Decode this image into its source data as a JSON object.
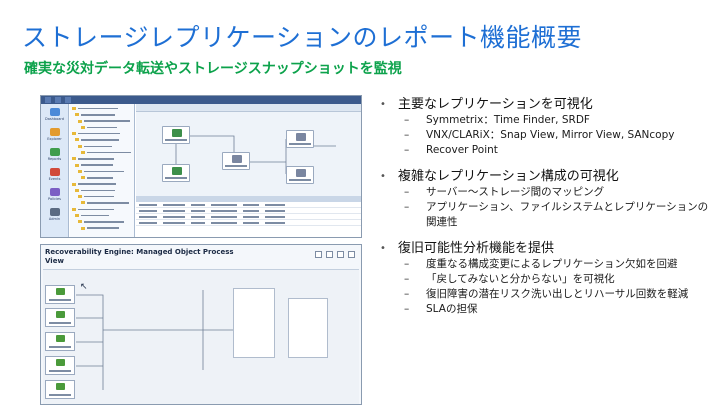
{
  "title": "ストレージレプリケーションのレポート機能概要",
  "subtitle": "確実な災対データ転送やストレージスナップショットを監視",
  "screenshot_top": {
    "nav_items": [
      "Dashboard",
      "Explorer",
      "Reports",
      "Events",
      "Policies",
      "Admin"
    ],
    "node_icons": [
      {
        "name": "app-node",
        "color": "#3d8f4a"
      },
      {
        "name": "host-node",
        "color": "#3d8f4a"
      },
      {
        "name": "storage-node",
        "color": "#7a86a0"
      },
      {
        "name": "array-node",
        "color": "#7a86a0"
      }
    ]
  },
  "screenshot_bottom": {
    "title_line1": "Recoverability Engine: Managed Object Process",
    "title_line2": "View"
  },
  "bullets": [
    {
      "label": "主要なレプリケーションを可視化",
      "subs": [
        [
          "Symmetrix：Time Finder, SRDF"
        ],
        [
          "VNX/CLARiX：Snap View, Mirror View, SANcopy"
        ],
        [
          "Recover Point"
        ]
      ]
    },
    {
      "label": "複雑なレプリケーション構成の可視化",
      "subs": [
        [
          "サーバー～ストレージ間のマッピング"
        ],
        [
          "アプリケーション、ファイルシステムとレプリケーションの",
          "関連性"
        ]
      ]
    },
    {
      "label": "復旧可能性分析機能を提供",
      "subs": [
        [
          "度重なる構成変更によるレプリケーション欠如を回避"
        ],
        [
          "「戻してみないと分からない」を可視化"
        ],
        [
          "復旧障害の潜在リスク洗い出しとリハーサル回数を軽減"
        ],
        [
          "SLAの担保"
        ]
      ]
    }
  ],
  "colors": {
    "title": "#1e6fd4",
    "subtitle": "#0ca24b"
  }
}
